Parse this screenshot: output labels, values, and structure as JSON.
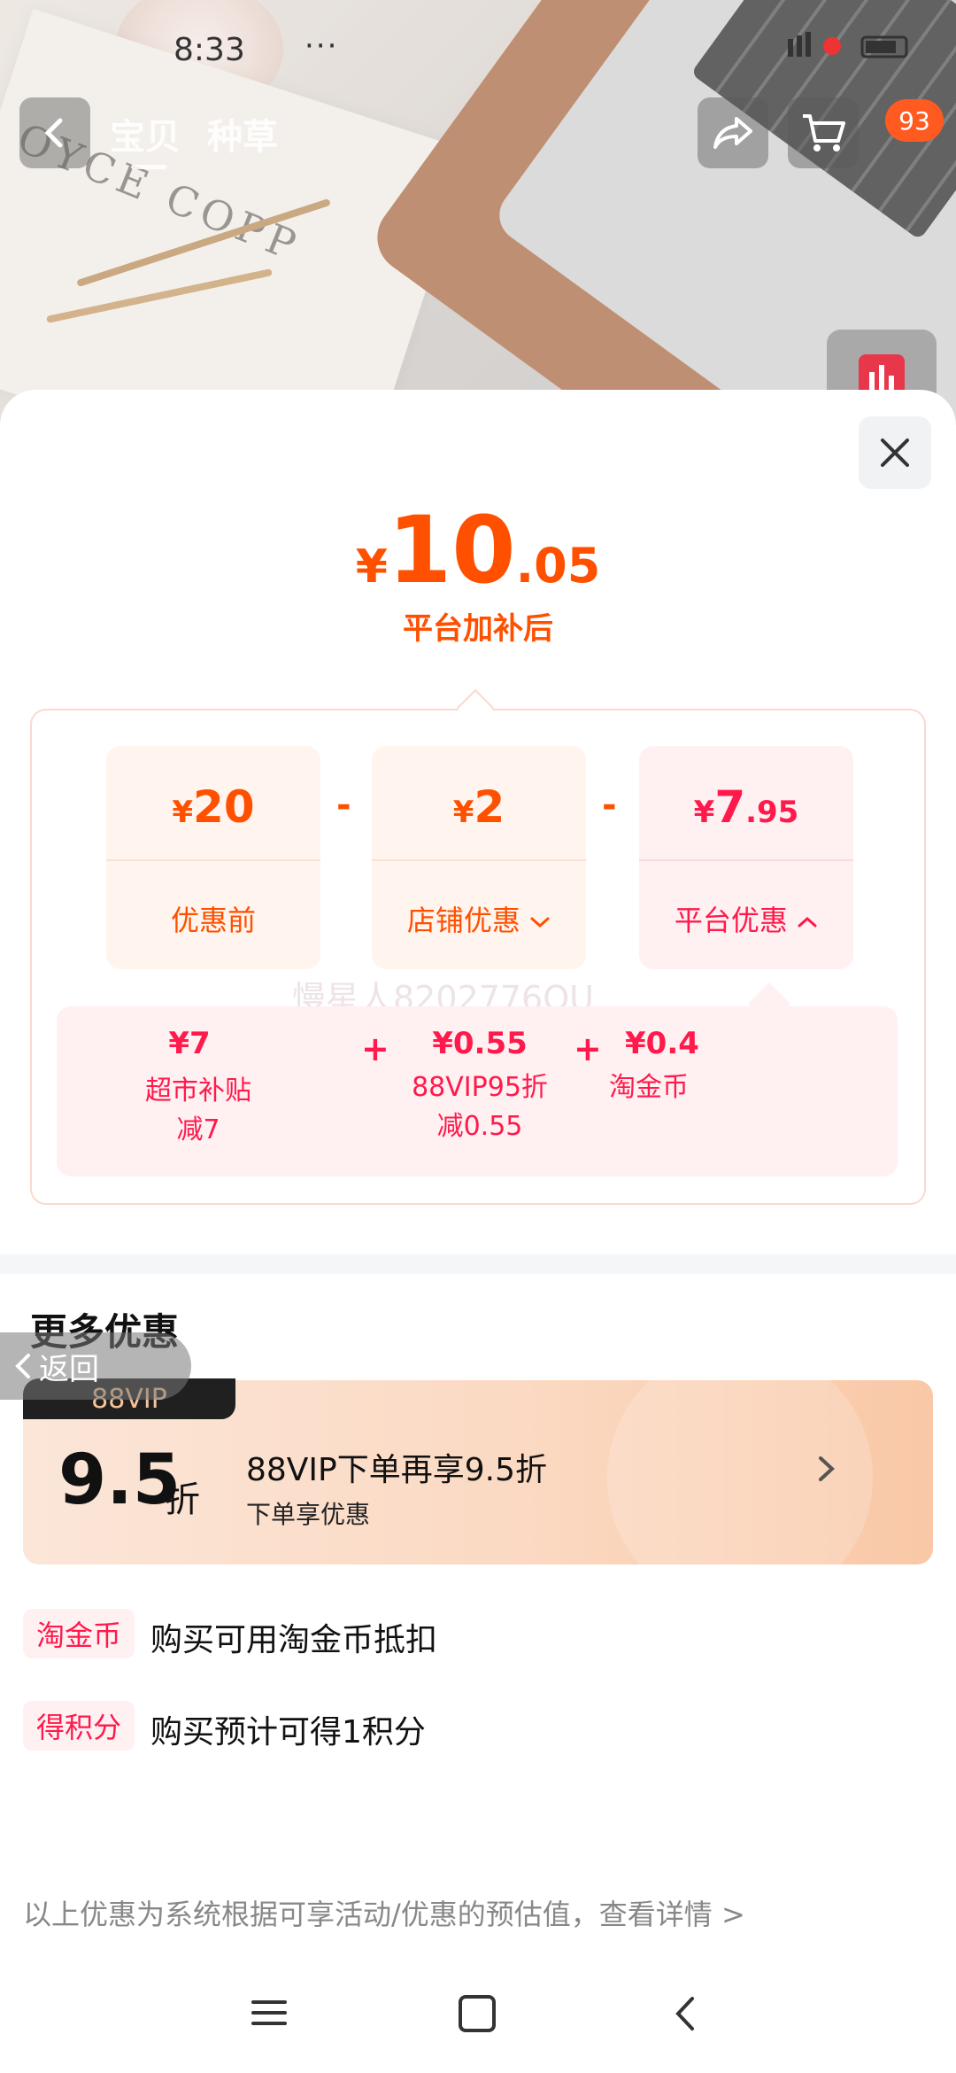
{
  "status_bar": {
    "time": "8:33",
    "dots": "···",
    "right": "1"
  },
  "nav": {
    "tabs": [
      "宝贝",
      "种草"
    ],
    "cart_badge": "93"
  },
  "price": {
    "currency": "¥",
    "integer": "10",
    "decimal": ".05",
    "subtitle": "平台加补后"
  },
  "breakdown": [
    {
      "currency": "¥",
      "integer": "20",
      "decimal": "",
      "label": "优惠前",
      "chevron": ""
    },
    {
      "currency": "¥",
      "integer": "2",
      "decimal": "",
      "label": "店铺优惠",
      "chevron": "down"
    },
    {
      "currency": "¥",
      "integer": "7",
      "decimal": ".95",
      "label": "平台优惠",
      "chevron": "up"
    }
  ],
  "operators": [
    "-",
    "-"
  ],
  "platform_details": [
    {
      "value": "¥7",
      "line1": "超市补贴",
      "line2": "减7"
    },
    {
      "value": "¥0.55",
      "line1": "88VIP95折",
      "line2": "减0.55"
    },
    {
      "value": "¥0.4",
      "line1": "淘金币",
      "line2": ""
    }
  ],
  "detail_operators": [
    "+",
    "+"
  ],
  "watermark": "慢星人8202776OU",
  "more": {
    "title": "更多优惠",
    "back_label": "返回",
    "vip": {
      "tag": "88VIP",
      "number": "9.5",
      "unit": "折",
      "title": "88VIP下单再享9.5折",
      "subtitle": "下单享优惠"
    },
    "rows": [
      {
        "tag": "淘金币",
        "text": "购买可用淘金币抵扣"
      },
      {
        "tag": "得积分",
        "text": "购买预计可得1积分"
      }
    ]
  },
  "footnote": "以上优惠为系统根据可享活动/优惠的预估值，查看详情 >",
  "colors": {
    "orange": "#ff5000",
    "pink": "#ff1a4b"
  }
}
